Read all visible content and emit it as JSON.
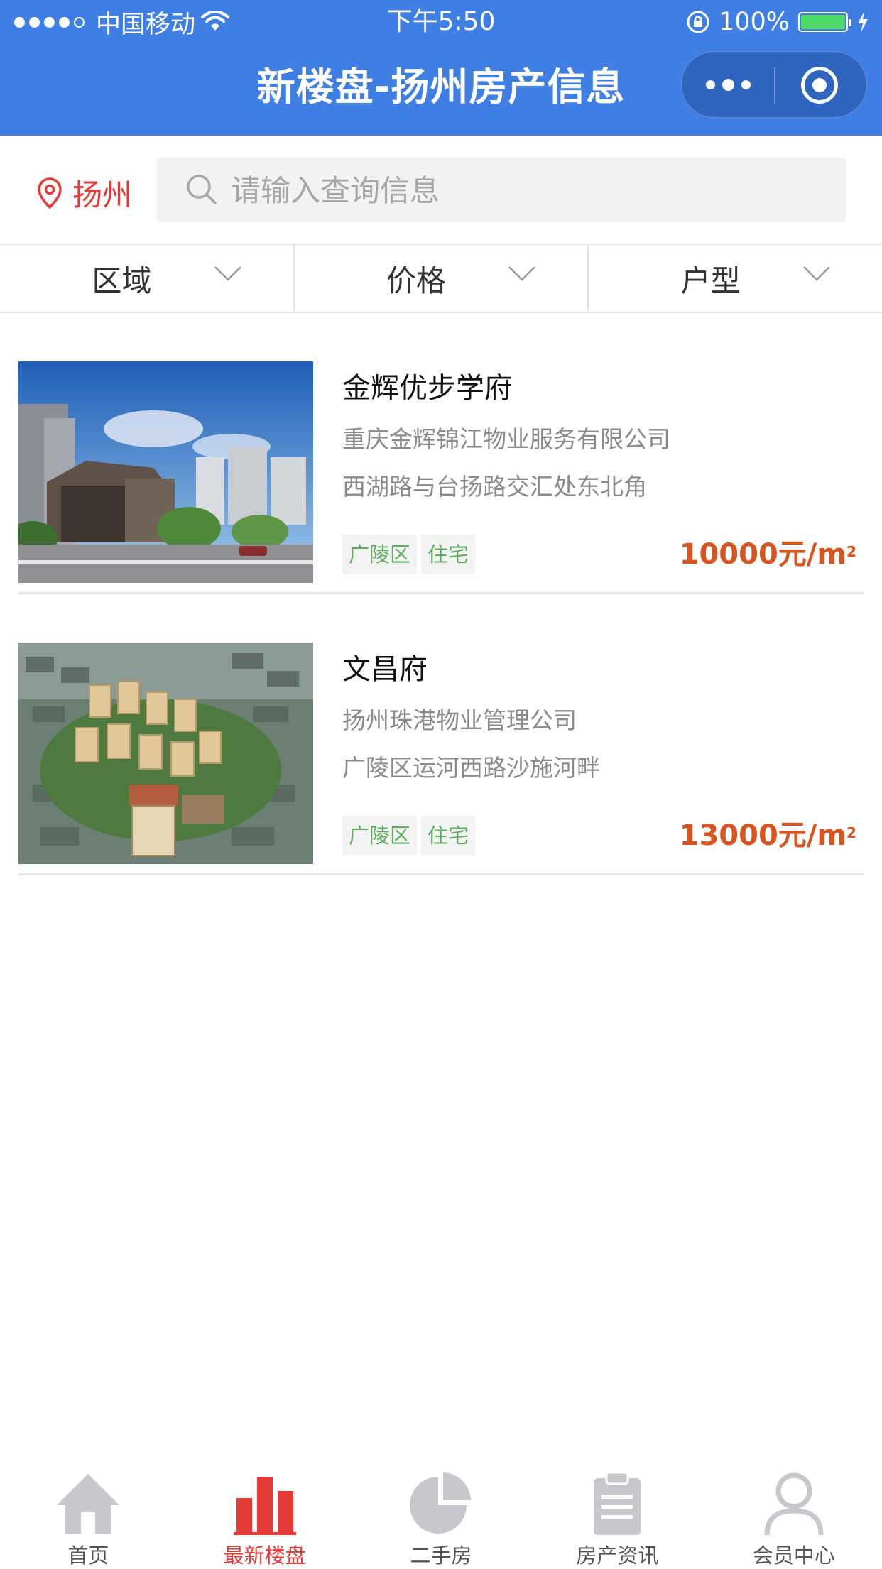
{
  "status_bar": {
    "carrier": "中国移动",
    "time": "下午5:50",
    "battery_pct": "100%",
    "battery_level": 1.0
  },
  "nav": {
    "title": "新楼盘-扬州房产信息"
  },
  "search": {
    "city": "扬州",
    "placeholder": "请输入查询信息",
    "value": ""
  },
  "filters": [
    "区域",
    "价格",
    "户型"
  ],
  "listings": [
    {
      "name": "金辉优步学府",
      "company": "重庆金辉锦江物业服务有限公司",
      "address": "西湖路与台扬路交汇处东北角",
      "tags": [
        "广陵区",
        "住宅"
      ],
      "price": "10000元/m",
      "price_unit_sup": "2"
    },
    {
      "name": "文昌府",
      "company": "扬州珠港物业管理公司",
      "address": "广陵区运河西路沙施河畔",
      "tags": [
        "广陵区",
        "住宅"
      ],
      "price": "13000元/m",
      "price_unit_sup": "2"
    }
  ],
  "tabbar": {
    "tabs": [
      {
        "label": "首页",
        "icon": "home-icon",
        "active": false
      },
      {
        "label": "最新楼盘",
        "icon": "bar-chart-icon",
        "active": true
      },
      {
        "label": "二手房",
        "icon": "pie-chart-icon",
        "active": false
      },
      {
        "label": "房产资讯",
        "icon": "clipboard-icon",
        "active": false
      },
      {
        "label": "会员中心",
        "icon": "user-icon",
        "active": false
      }
    ]
  },
  "colors": {
    "header_bg": "#3f7ee2",
    "accent_red": "#e53935",
    "price_orange": "#d9541e",
    "tag_green": "#5fae5f",
    "icon_gray": "#c7c7cc"
  }
}
